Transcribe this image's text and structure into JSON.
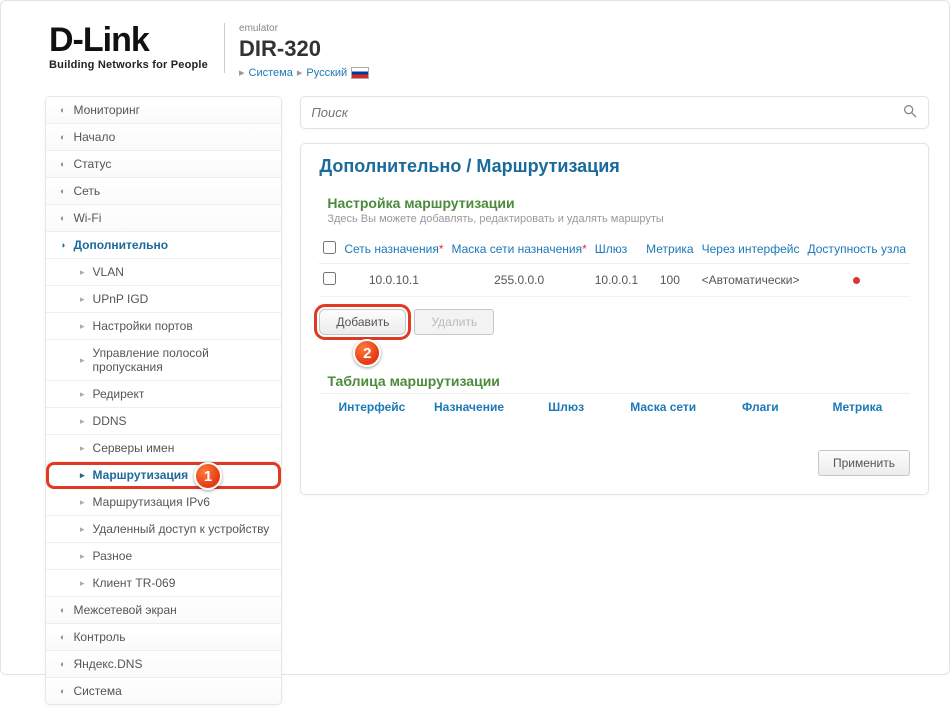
{
  "header": {
    "brand": "D-Link",
    "tagline": "Building Networks for People",
    "emulator_label": "emulator",
    "model": "DIR-320",
    "system_link": "Система",
    "lang_link": "Русский"
  },
  "sidebar": {
    "items": [
      {
        "label": "Мониторинг"
      },
      {
        "label": "Начало"
      },
      {
        "label": "Статус"
      },
      {
        "label": "Сеть"
      },
      {
        "label": "Wi-Fi"
      },
      {
        "label": "Дополнительно",
        "expanded": true,
        "children": [
          {
            "label": "VLAN"
          },
          {
            "label": "UPnP IGD"
          },
          {
            "label": "Настройки портов"
          },
          {
            "label": "Управление полосой пропускания"
          },
          {
            "label": "Редирект"
          },
          {
            "label": "DDNS"
          },
          {
            "label": "Серверы имен"
          },
          {
            "label": "Маршрутизация",
            "active": true,
            "highlight": true
          },
          {
            "label": "Маршрутизация IPv6"
          },
          {
            "label": "Удаленный доступ к устройству"
          },
          {
            "label": "Разное"
          },
          {
            "label": "Клиент TR-069"
          }
        ]
      },
      {
        "label": "Межсетевой экран"
      },
      {
        "label": "Контроль"
      },
      {
        "label": "Яндекс.DNS"
      },
      {
        "label": "Система"
      }
    ]
  },
  "search": {
    "placeholder": "Поиск"
  },
  "page": {
    "title": "Дополнительно  /  Маршрутизация",
    "section_title": "Настройка маршрутизации",
    "section_desc": "Здесь Вы можете добавлять, редактировать и удалять маршруты",
    "columns": {
      "dest": "Сеть назначения",
      "mask": "Маска сети назначения",
      "gateway": "Шлюз",
      "metric": "Метрика",
      "iface": "Через интерфейс",
      "avail": "Доступность узла"
    },
    "rows": [
      {
        "dest": "10.0.10.1",
        "mask": "255.0.0.0",
        "gateway": "10.0.0.1",
        "metric": "100",
        "iface": "<Автоматически>"
      }
    ],
    "add_label": "Добавить",
    "delete_label": "Удалить",
    "rt_title": "Таблица маршрутизации",
    "rt_columns": {
      "iface": "Интерфейс",
      "dest": "Назначение",
      "gateway": "Шлюз",
      "mask": "Маска сети",
      "flags": "Флаги",
      "metric": "Метрика"
    },
    "apply_label": "Применить"
  },
  "annotations": {
    "badge1": "1",
    "badge2": "2"
  }
}
